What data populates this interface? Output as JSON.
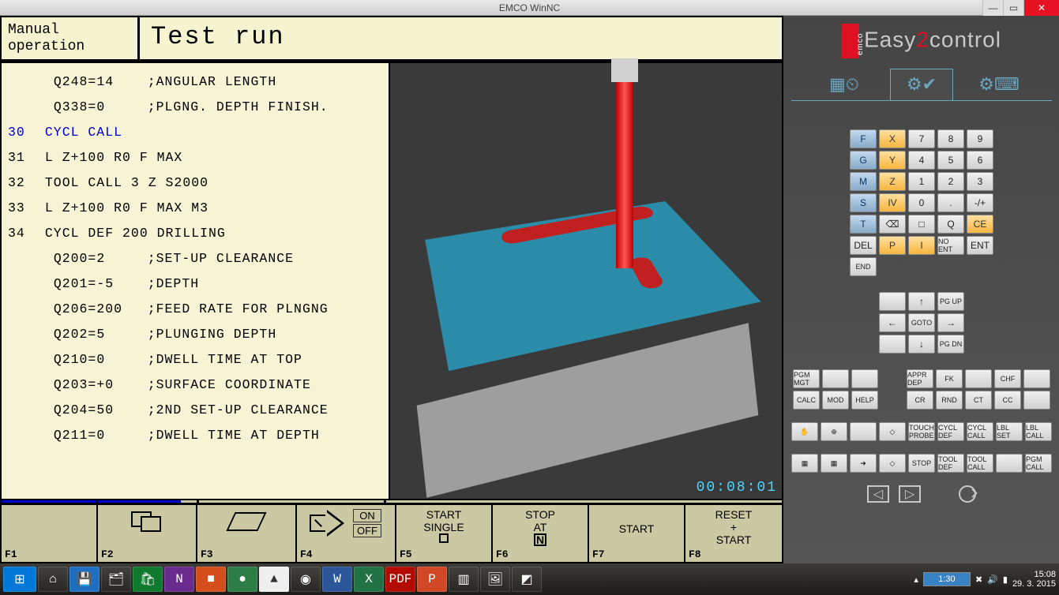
{
  "window": {
    "title": "EMCO WinNC"
  },
  "cnc": {
    "mode_line1": "Manual",
    "mode_line2": "operation",
    "title": "Test run",
    "lines": [
      {
        "ln": "",
        "param": "Q248=14",
        "txt": ";ANGULAR LENGTH",
        "hl": false
      },
      {
        "ln": "",
        "param": "Q338=0",
        "txt": ";PLGNG. DEPTH FINISH.",
        "hl": false
      },
      {
        "ln": "30",
        "param": "",
        "txt": "CYCL CALL",
        "hl": true
      },
      {
        "ln": "31",
        "param": "",
        "txt": "L Z+100 R0 F MAX",
        "hl": false
      },
      {
        "ln": "32",
        "param": "",
        "txt": "TOOL CALL 3 Z S2000",
        "hl": false
      },
      {
        "ln": "33",
        "param": "",
        "txt": "L Z+100 R0 F MAX M3",
        "hl": false
      },
      {
        "ln": "34",
        "param": "",
        "txt": "CYCL DEF 200 DRILLING",
        "hl": false
      },
      {
        "ln": "",
        "param": "Q200=2",
        "txt": ";SET-UP CLEARANCE",
        "hl": false
      },
      {
        "ln": "",
        "param": "Q201=-5",
        "txt": ";DEPTH",
        "hl": false
      },
      {
        "ln": "",
        "param": "Q206=200",
        "txt": ";FEED RATE FOR PLNGNG",
        "hl": false
      },
      {
        "ln": "",
        "param": "Q202=5",
        "txt": ";PLUNGING DEPTH",
        "hl": false
      },
      {
        "ln": "",
        "param": "Q210=0",
        "txt": ";DWELL TIME AT TOP",
        "hl": false
      },
      {
        "ln": "",
        "param": "Q203=+0",
        "txt": ";SURFACE COORDINATE",
        "hl": false
      },
      {
        "ln": "",
        "param": "Q204=50",
        "txt": ";2ND SET-UP CLEARANCE",
        "hl": false
      },
      {
        "ln": "",
        "param": "Q211=0",
        "txt": ";DWELL TIME AT DEPTH",
        "hl": false
      }
    ],
    "sim_time": "00:08:01",
    "softkeys": {
      "f1": "F1",
      "f2": "F2",
      "f3": "F3",
      "f4": "F4",
      "f4_on": "ON",
      "f4_off": "OFF",
      "f5": "F5",
      "f5_l1": "START",
      "f5_l2": "SINGLE",
      "f6": "F6",
      "f6_l1": "STOP",
      "f6_l2": "AT",
      "f6_N": "N",
      "f7": "F7",
      "f7_l1": "START",
      "f8": "F8",
      "f8_l1": "RESET",
      "f8_l2": "+",
      "f8_l3": "START"
    }
  },
  "e2c": {
    "brand_easy": "Easy",
    "brand_2": "2",
    "brand_control": "control",
    "keypad": [
      [
        "F",
        "X",
        "7",
        "8",
        "9"
      ],
      [
        "G",
        "Y",
        "4",
        "5",
        "6"
      ],
      [
        "M",
        "Z",
        "1",
        "2",
        "3"
      ],
      [
        "S",
        "IV",
        "0",
        ".",
        "-/+"
      ],
      [
        "T",
        "",
        "⌫",
        "□",
        "Q"
      ],
      [
        "CE",
        "DEL",
        "P",
        "I",
        ""
      ],
      [
        "NO ENT",
        "ENT",
        "END",
        "",
        ""
      ]
    ],
    "keypad_styles": [
      [
        "blue",
        "orange",
        "",
        "",
        ""
      ],
      [
        "blue",
        "orange",
        "",
        "",
        ""
      ],
      [
        "blue",
        "orange",
        "",
        "",
        ""
      ],
      [
        "blue",
        "orange",
        "",
        "",
        ""
      ],
      [
        "blue",
        "",
        "",
        "",
        ""
      ],
      [
        "orange",
        "",
        "orange",
        "orange",
        ""
      ],
      [
        "small",
        "",
        "small",
        "",
        ""
      ]
    ],
    "nav": [
      [
        "",
        "↑",
        "PG UP"
      ],
      [
        "←",
        "GOTO",
        "→"
      ],
      [
        "",
        "↓",
        "PG DN"
      ]
    ],
    "fcluster_left": [
      [
        "PGM MGT",
        "",
        ""
      ],
      [
        "CALC",
        "MOD",
        "HELP"
      ]
    ],
    "fcluster_right": [
      [
        "APPR DEP",
        "FK",
        "",
        "CHF",
        ""
      ],
      [
        "CR",
        "RND",
        "CT",
        "CC",
        ""
      ]
    ],
    "iconrow1": [
      "✋",
      "⊕",
      "",
      "◇",
      "TOUCH PROBE",
      "CYCL DEF",
      "CYCL CALL",
      "LBL SET",
      "LBL CALL"
    ],
    "iconrow2": [
      "▦",
      "▦",
      "➜",
      "◇",
      "STOP",
      "TOOL DEF",
      "TOOL CALL",
      "",
      "PGM CALL"
    ]
  },
  "taskbar": {
    "battery": "1:30",
    "time": "15:08",
    "date": "29. 3. 2015"
  }
}
